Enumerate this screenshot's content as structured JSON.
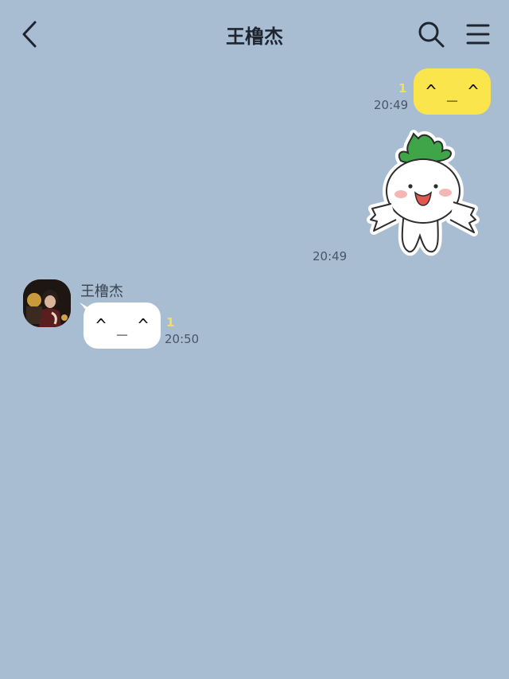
{
  "header": {
    "title": "王橹杰",
    "back_icon": "chevron-left-icon",
    "search_icon": "search-icon",
    "menu_icon": "hamburger-menu-icon"
  },
  "messages": [
    {
      "side": "outgoing",
      "type": "text",
      "text": "^ _ ^",
      "read_count": "1",
      "time": "20:49",
      "bubble_color": "#fbe54d"
    },
    {
      "side": "outgoing",
      "type": "sticker",
      "sticker": "radish-character-sticker",
      "time": "20:49"
    },
    {
      "side": "incoming",
      "sender": "王橹杰",
      "type": "text",
      "text": "^ _ ^",
      "read_count": "1",
      "time": "20:50",
      "bubble_color": "#ffffff"
    }
  ],
  "colors": {
    "background": "#a9bdd2",
    "outgoing_bubble": "#fbe54d",
    "incoming_bubble": "#ffffff",
    "read_count": "#f3e05a"
  }
}
